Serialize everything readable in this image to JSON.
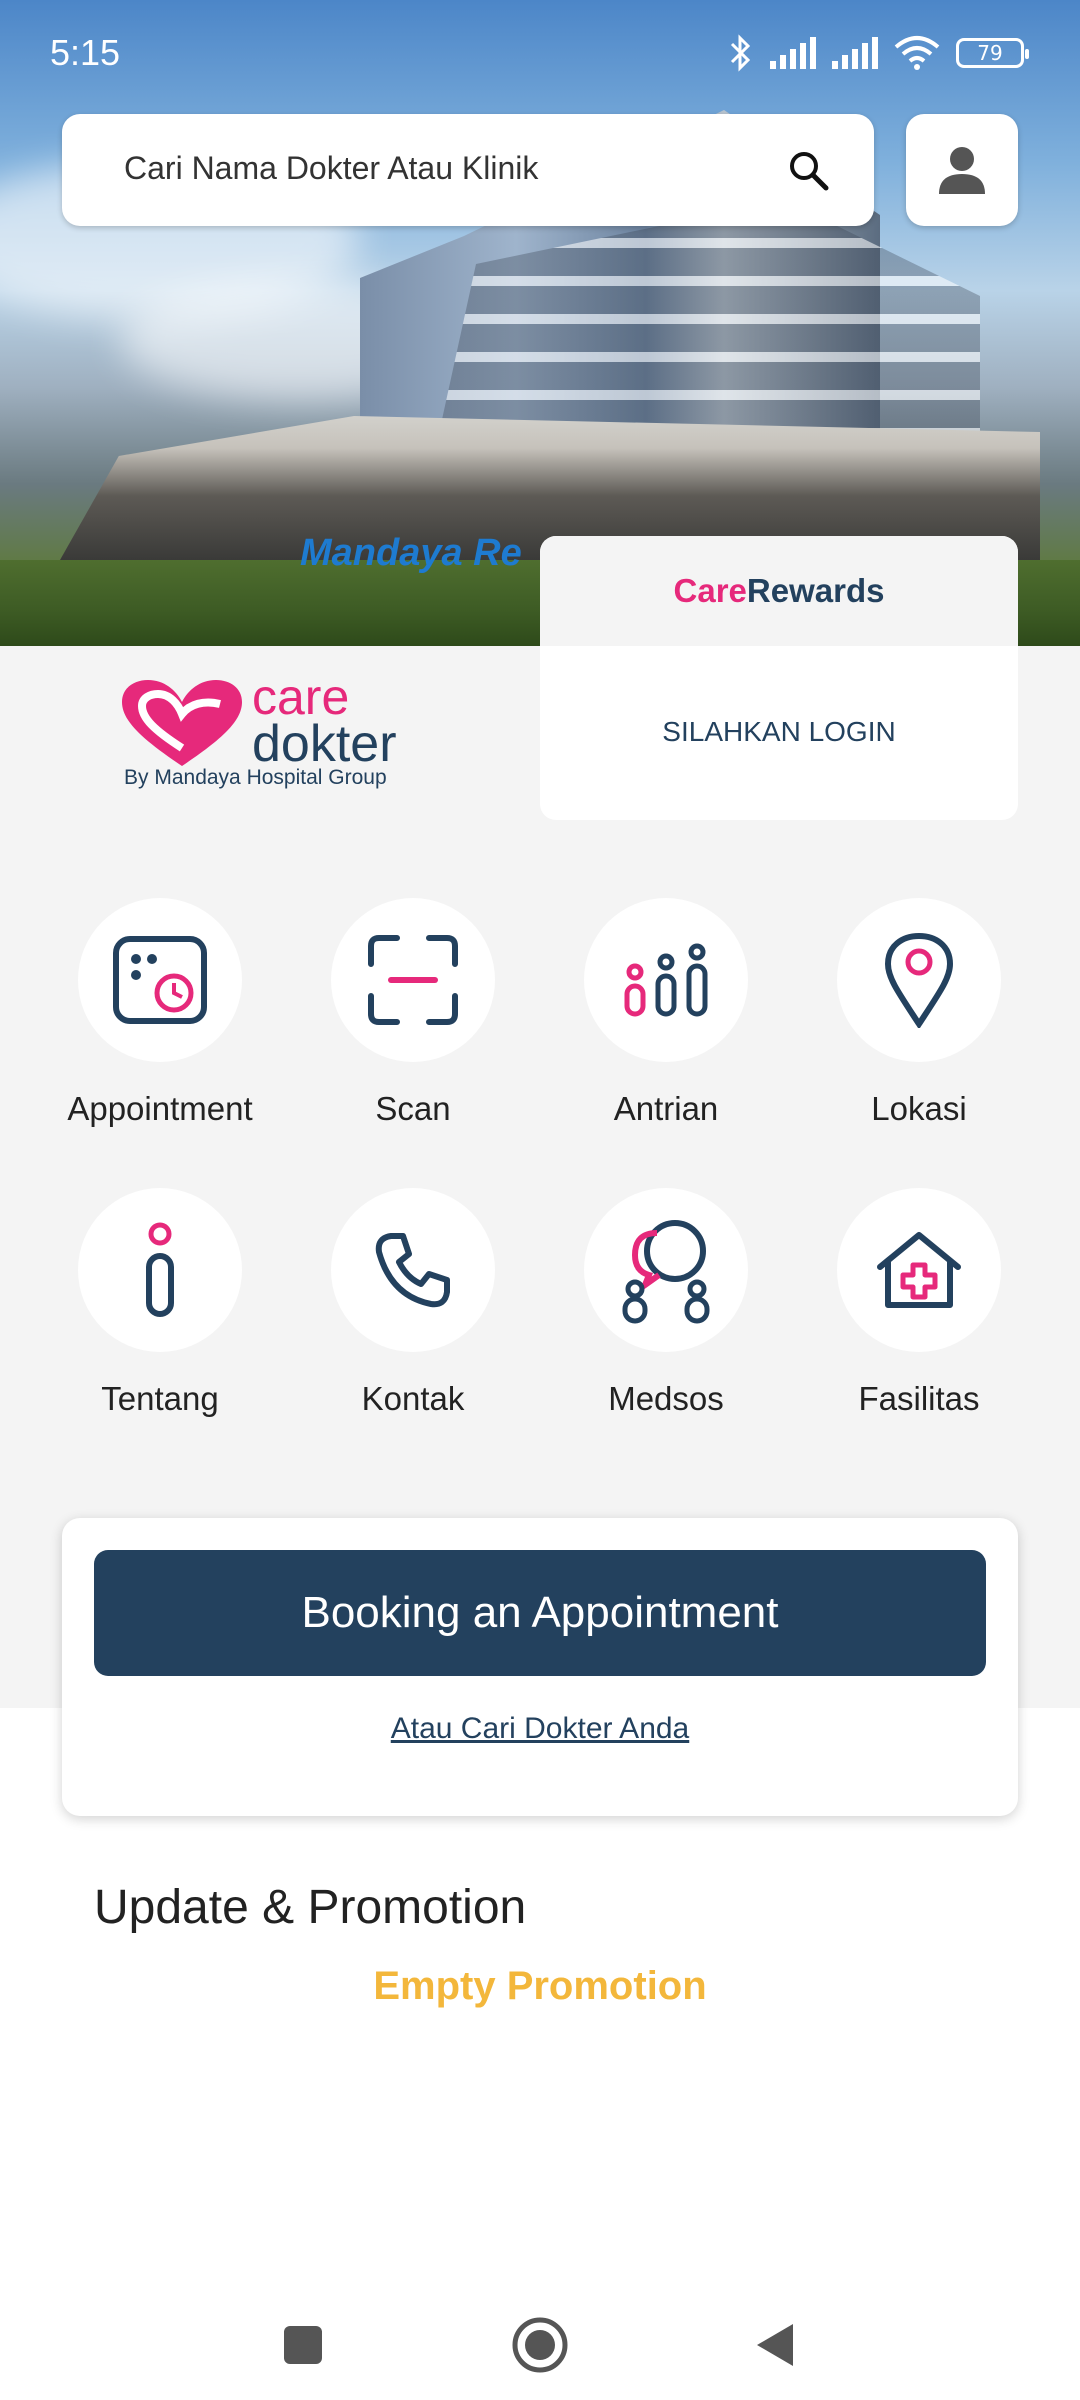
{
  "status_bar": {
    "time": "5:15",
    "battery": "79"
  },
  "search": {
    "placeholder": "Cari Nama Dokter Atau Klinik"
  },
  "hero": {
    "sign_text": "Mandaya Re"
  },
  "brand": {
    "care": "care",
    "dokter": "dokter",
    "subtitle": "By Mandaya Hospital Group"
  },
  "rewards": {
    "title_care": "Care",
    "title_rewards": "Rewards",
    "login_text": "SILAHKAN LOGIN"
  },
  "menu": {
    "items": [
      {
        "label": "Appointment",
        "icon": "calendar-clock-icon"
      },
      {
        "label": "Scan",
        "icon": "scan-icon"
      },
      {
        "label": "Antrian",
        "icon": "queue-icon"
      },
      {
        "label": "Lokasi",
        "icon": "location-pin-icon"
      },
      {
        "label": "Tentang",
        "icon": "info-icon"
      },
      {
        "label": "Kontak",
        "icon": "phone-icon"
      },
      {
        "label": "Medsos",
        "icon": "social-media-icon"
      },
      {
        "label": "Fasilitas",
        "icon": "hospital-house-icon"
      }
    ]
  },
  "booking": {
    "button_label": "Booking an Appointment",
    "link_label": "Atau Cari Dokter Anda"
  },
  "promo": {
    "title": "Update & Promotion",
    "empty_text": "Empty Promotion"
  },
  "colors": {
    "navy": "#23415e",
    "pink": "#e6297b",
    "yellow": "#f3b73b"
  }
}
